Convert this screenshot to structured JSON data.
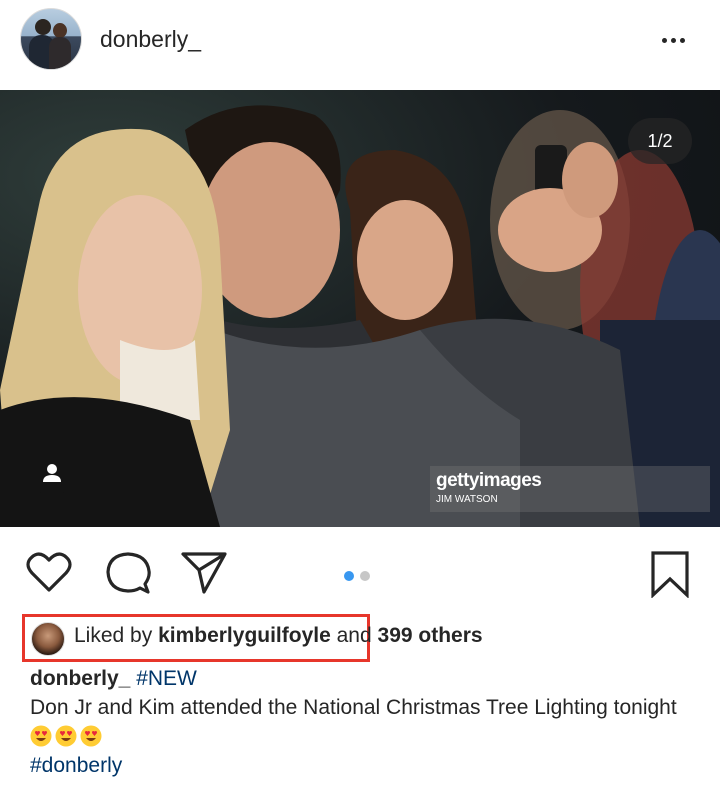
{
  "header": {
    "username": "donberly_"
  },
  "photo": {
    "page_indicator": "1/2",
    "watermark_brand": "gettyimages",
    "watermark_credit": "JIM WATSON",
    "carousel_index": 1,
    "carousel_count": 2
  },
  "likes": {
    "prefix": "Liked by",
    "liker": "kimberlyguilfoyle",
    "and_text": "and",
    "others": "399 others"
  },
  "caption": {
    "username": "donberly_",
    "tag": "#NEW",
    "text": "Don Jr and Kim attended the National Christmas Tree Lighting tonight",
    "emojis": [
      "heart-eyes",
      "heart-eyes",
      "heart-eyes"
    ],
    "hashtag": "#donberly"
  },
  "colors": {
    "accent_blue": "#3897f0",
    "inactive_dot": "#c7c7c7",
    "highlight_red": "#e7362b",
    "hashtag": "#003569"
  }
}
